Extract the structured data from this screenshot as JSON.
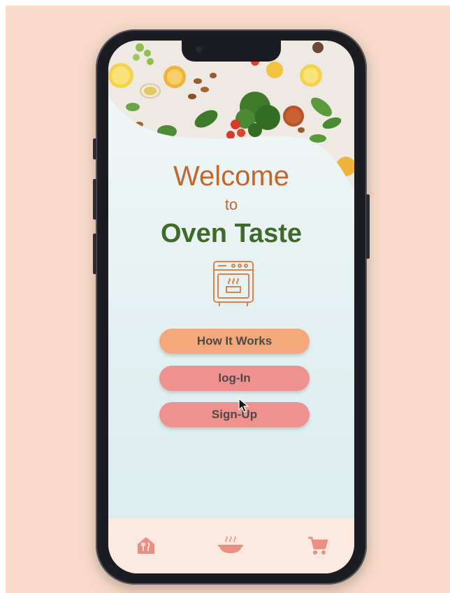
{
  "app": {
    "welcome": "Welcome",
    "to": "to",
    "brand": "Oven Taste"
  },
  "buttons": {
    "how_it_works": "How It Works",
    "login": "log-In",
    "signup": "Sign-Up"
  },
  "nav": {
    "items": [
      {
        "icon": "home-icon"
      },
      {
        "icon": "dish-icon"
      },
      {
        "icon": "cart-icon"
      }
    ]
  },
  "colors": {
    "accent_orange": "#c1672c",
    "brand_green": "#3e6a2a",
    "button_primary": "#f4a77a",
    "button_secondary": "#ef918e",
    "nav_icon": "#ec8f83"
  }
}
